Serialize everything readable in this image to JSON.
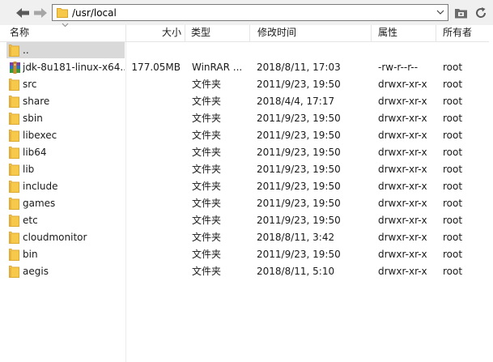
{
  "toolbar": {
    "path_value": "/usr/local"
  },
  "columns": {
    "name": "名称",
    "size": "大小",
    "type": "类型",
    "modified": "修改时间",
    "permissions": "属性",
    "owner": "所有者"
  },
  "rows": [
    {
      "name": "..",
      "size": "",
      "type": "",
      "modified": "",
      "permissions": "",
      "owner": "",
      "icon": "folder-icon"
    },
    {
      "name": "jdk-8u181-linux-x64...",
      "size": "177.05MB",
      "type": "WinRAR ...",
      "modified": "2018/8/11, 17:03",
      "permissions": "-rw-r--r--",
      "owner": "root",
      "icon": "archive-icon"
    },
    {
      "name": "src",
      "size": "",
      "type": "文件夹",
      "modified": "2011/9/23, 19:50",
      "permissions": "drwxr-xr-x",
      "owner": "root",
      "icon": "folder-icon"
    },
    {
      "name": "share",
      "size": "",
      "type": "文件夹",
      "modified": "2018/4/4, 17:17",
      "permissions": "drwxr-xr-x",
      "owner": "root",
      "icon": "folder-icon"
    },
    {
      "name": "sbin",
      "size": "",
      "type": "文件夹",
      "modified": "2011/9/23, 19:50",
      "permissions": "drwxr-xr-x",
      "owner": "root",
      "icon": "folder-icon"
    },
    {
      "name": "libexec",
      "size": "",
      "type": "文件夹",
      "modified": "2011/9/23, 19:50",
      "permissions": "drwxr-xr-x",
      "owner": "root",
      "icon": "folder-icon"
    },
    {
      "name": "lib64",
      "size": "",
      "type": "文件夹",
      "modified": "2011/9/23, 19:50",
      "permissions": "drwxr-xr-x",
      "owner": "root",
      "icon": "folder-icon"
    },
    {
      "name": "lib",
      "size": "",
      "type": "文件夹",
      "modified": "2011/9/23, 19:50",
      "permissions": "drwxr-xr-x",
      "owner": "root",
      "icon": "folder-icon"
    },
    {
      "name": "include",
      "size": "",
      "type": "文件夹",
      "modified": "2011/9/23, 19:50",
      "permissions": "drwxr-xr-x",
      "owner": "root",
      "icon": "folder-icon"
    },
    {
      "name": "games",
      "size": "",
      "type": "文件夹",
      "modified": "2011/9/23, 19:50",
      "permissions": "drwxr-xr-x",
      "owner": "root",
      "icon": "folder-icon"
    },
    {
      "name": "etc",
      "size": "",
      "type": "文件夹",
      "modified": "2011/9/23, 19:50",
      "permissions": "drwxr-xr-x",
      "owner": "root",
      "icon": "folder-icon"
    },
    {
      "name": "cloudmonitor",
      "size": "",
      "type": "文件夹",
      "modified": "2018/8/11, 3:42",
      "permissions": "drwxr-xr-x",
      "owner": "root",
      "icon": "folder-icon"
    },
    {
      "name": "bin",
      "size": "",
      "type": "文件夹",
      "modified": "2011/9/23, 19:50",
      "permissions": "drwxr-xr-x",
      "owner": "root",
      "icon": "folder-icon"
    },
    {
      "name": "aegis",
      "size": "",
      "type": "文件夹",
      "modified": "2018/8/11, 5:10",
      "permissions": "drwxr-xr-x",
      "owner": "root",
      "icon": "folder-icon"
    }
  ],
  "colors": {
    "folder": "#f6c94a",
    "folder_dark": "#e0a92a",
    "selection": "#d9d9d9",
    "toolbar_bg": "#f0f0f0"
  }
}
